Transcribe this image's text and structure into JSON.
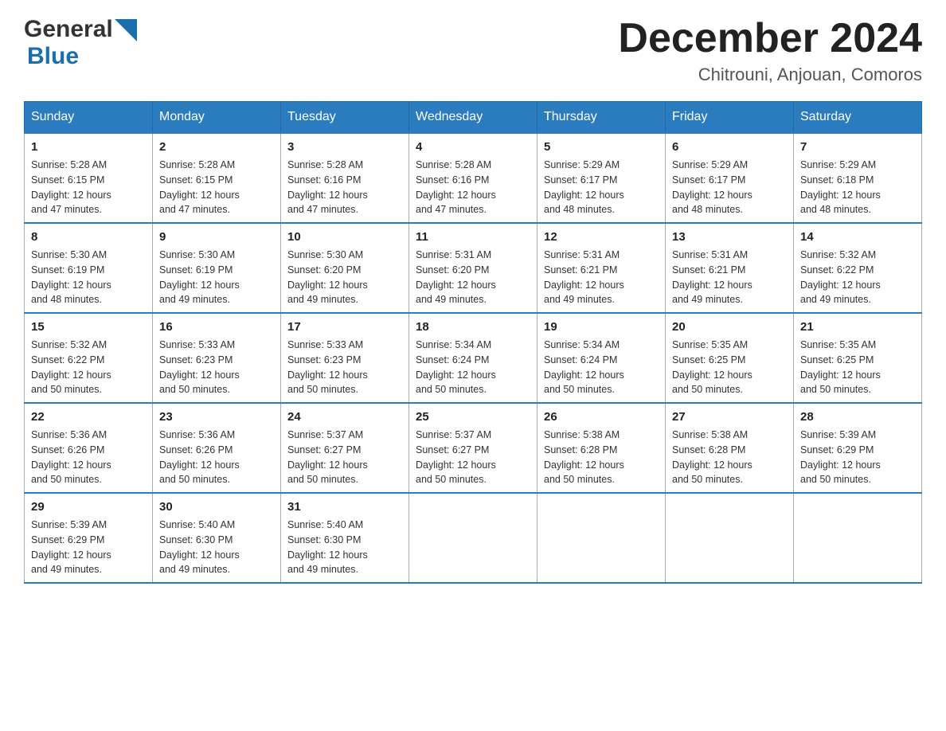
{
  "header": {
    "title": "December 2024",
    "location": "Chitrouni, Anjouan, Comoros"
  },
  "logo": {
    "text_general": "General",
    "text_blue": "Blue"
  },
  "weekdays": [
    "Sunday",
    "Monday",
    "Tuesday",
    "Wednesday",
    "Thursday",
    "Friday",
    "Saturday"
  ],
  "weeks": [
    [
      {
        "day": "1",
        "sunrise": "5:28 AM",
        "sunset": "6:15 PM",
        "daylight": "12 hours and 47 minutes."
      },
      {
        "day": "2",
        "sunrise": "5:28 AM",
        "sunset": "6:15 PM",
        "daylight": "12 hours and 47 minutes."
      },
      {
        "day": "3",
        "sunrise": "5:28 AM",
        "sunset": "6:16 PM",
        "daylight": "12 hours and 47 minutes."
      },
      {
        "day": "4",
        "sunrise": "5:28 AM",
        "sunset": "6:16 PM",
        "daylight": "12 hours and 47 minutes."
      },
      {
        "day": "5",
        "sunrise": "5:29 AM",
        "sunset": "6:17 PM",
        "daylight": "12 hours and 48 minutes."
      },
      {
        "day": "6",
        "sunrise": "5:29 AM",
        "sunset": "6:17 PM",
        "daylight": "12 hours and 48 minutes."
      },
      {
        "day": "7",
        "sunrise": "5:29 AM",
        "sunset": "6:18 PM",
        "daylight": "12 hours and 48 minutes."
      }
    ],
    [
      {
        "day": "8",
        "sunrise": "5:30 AM",
        "sunset": "6:19 PM",
        "daylight": "12 hours and 48 minutes."
      },
      {
        "day": "9",
        "sunrise": "5:30 AM",
        "sunset": "6:19 PM",
        "daylight": "12 hours and 49 minutes."
      },
      {
        "day": "10",
        "sunrise": "5:30 AM",
        "sunset": "6:20 PM",
        "daylight": "12 hours and 49 minutes."
      },
      {
        "day": "11",
        "sunrise": "5:31 AM",
        "sunset": "6:20 PM",
        "daylight": "12 hours and 49 minutes."
      },
      {
        "day": "12",
        "sunrise": "5:31 AM",
        "sunset": "6:21 PM",
        "daylight": "12 hours and 49 minutes."
      },
      {
        "day": "13",
        "sunrise": "5:31 AM",
        "sunset": "6:21 PM",
        "daylight": "12 hours and 49 minutes."
      },
      {
        "day": "14",
        "sunrise": "5:32 AM",
        "sunset": "6:22 PM",
        "daylight": "12 hours and 49 minutes."
      }
    ],
    [
      {
        "day": "15",
        "sunrise": "5:32 AM",
        "sunset": "6:22 PM",
        "daylight": "12 hours and 50 minutes."
      },
      {
        "day": "16",
        "sunrise": "5:33 AM",
        "sunset": "6:23 PM",
        "daylight": "12 hours and 50 minutes."
      },
      {
        "day": "17",
        "sunrise": "5:33 AM",
        "sunset": "6:23 PM",
        "daylight": "12 hours and 50 minutes."
      },
      {
        "day": "18",
        "sunrise": "5:34 AM",
        "sunset": "6:24 PM",
        "daylight": "12 hours and 50 minutes."
      },
      {
        "day": "19",
        "sunrise": "5:34 AM",
        "sunset": "6:24 PM",
        "daylight": "12 hours and 50 minutes."
      },
      {
        "day": "20",
        "sunrise": "5:35 AM",
        "sunset": "6:25 PM",
        "daylight": "12 hours and 50 minutes."
      },
      {
        "day": "21",
        "sunrise": "5:35 AM",
        "sunset": "6:25 PM",
        "daylight": "12 hours and 50 minutes."
      }
    ],
    [
      {
        "day": "22",
        "sunrise": "5:36 AM",
        "sunset": "6:26 PM",
        "daylight": "12 hours and 50 minutes."
      },
      {
        "day": "23",
        "sunrise": "5:36 AM",
        "sunset": "6:26 PM",
        "daylight": "12 hours and 50 minutes."
      },
      {
        "day": "24",
        "sunrise": "5:37 AM",
        "sunset": "6:27 PM",
        "daylight": "12 hours and 50 minutes."
      },
      {
        "day": "25",
        "sunrise": "5:37 AM",
        "sunset": "6:27 PM",
        "daylight": "12 hours and 50 minutes."
      },
      {
        "day": "26",
        "sunrise": "5:38 AM",
        "sunset": "6:28 PM",
        "daylight": "12 hours and 50 minutes."
      },
      {
        "day": "27",
        "sunrise": "5:38 AM",
        "sunset": "6:28 PM",
        "daylight": "12 hours and 50 minutes."
      },
      {
        "day": "28",
        "sunrise": "5:39 AM",
        "sunset": "6:29 PM",
        "daylight": "12 hours and 50 minutes."
      }
    ],
    [
      {
        "day": "29",
        "sunrise": "5:39 AM",
        "sunset": "6:29 PM",
        "daylight": "12 hours and 49 minutes."
      },
      {
        "day": "30",
        "sunrise": "5:40 AM",
        "sunset": "6:30 PM",
        "daylight": "12 hours and 49 minutes."
      },
      {
        "day": "31",
        "sunrise": "5:40 AM",
        "sunset": "6:30 PM",
        "daylight": "12 hours and 49 minutes."
      },
      null,
      null,
      null,
      null
    ]
  ],
  "labels": {
    "sunrise": "Sunrise:",
    "sunset": "Sunset:",
    "daylight": "Daylight:"
  }
}
